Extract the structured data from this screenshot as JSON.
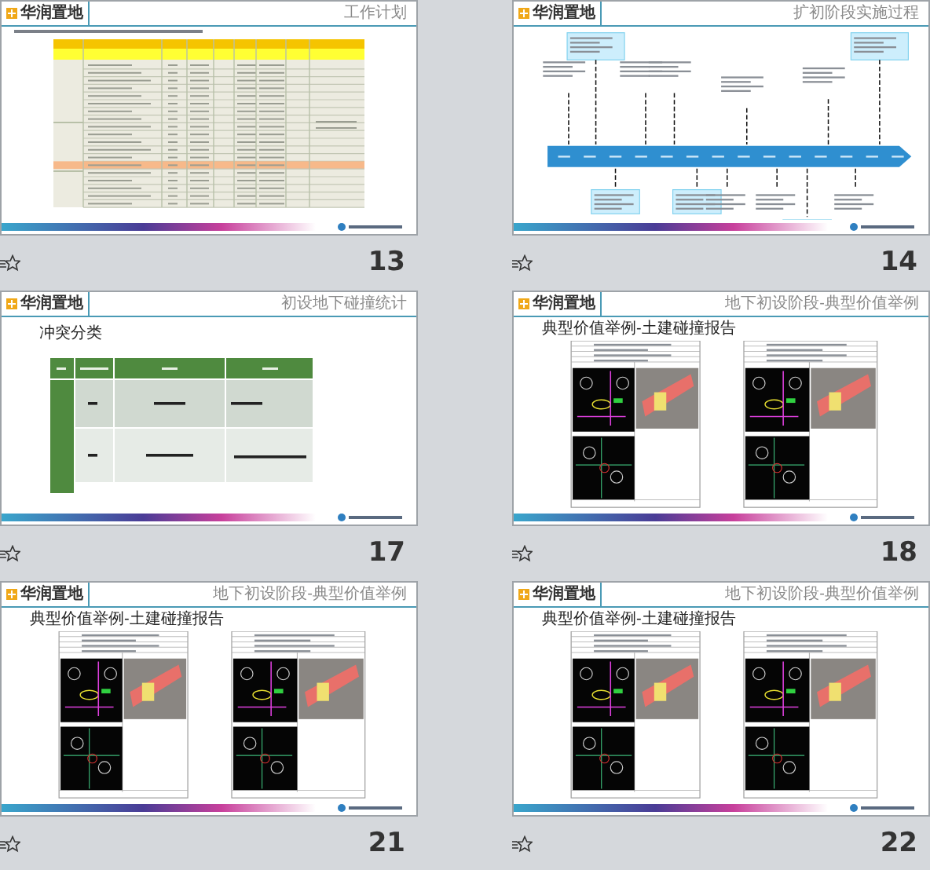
{
  "slides": [
    {
      "number": "13",
      "kind": "table",
      "logo": "华润置地",
      "header": "工作计划"
    },
    {
      "number": "14",
      "kind": "timeline",
      "logo": "华润置地",
      "header": "扩初阶段实施过程"
    },
    {
      "number": "17",
      "kind": "conflict",
      "logo": "华润置地",
      "header": "初设地下碰撞统计",
      "title": "冲突分类"
    },
    {
      "number": "18",
      "kind": "report",
      "logo": "华润置地",
      "header": "地下初设阶段-典型价值举例",
      "title": "典型价值举例-土建碰撞报告"
    },
    {
      "number": "21",
      "kind": "report",
      "logo": "华润置地",
      "header": "地下初设阶段-典型价值举例",
      "title": "典型价值举例-土建碰撞报告"
    },
    {
      "number": "22",
      "kind": "report",
      "logo": "华润置地",
      "header": "地下初设阶段-典型价值举例",
      "title": "典型价值举例-土建碰撞报告"
    }
  ]
}
